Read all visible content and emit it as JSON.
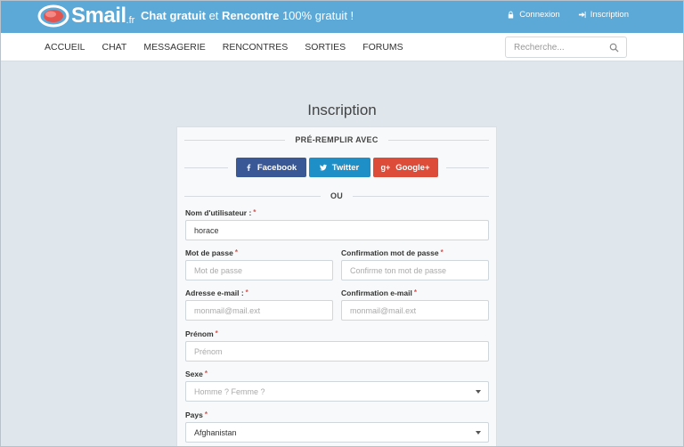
{
  "header": {
    "logo_text": "Smail",
    "logo_tld": ".fr",
    "tagline_part1": "Chat gratuit",
    "tagline_part2": " et ",
    "tagline_part3": "Rencontre",
    "tagline_part4": " 100% gratuit !",
    "connexion": "Connexion",
    "inscription": "Inscription",
    "accent_color": "#5ca8d6"
  },
  "nav": {
    "items": [
      "ACCUEIL",
      "CHAT",
      "MESSAGERIE",
      "RENCONTRES",
      "SORTIES",
      "FORUMS"
    ],
    "search_placeholder": "Recherche..."
  },
  "page": {
    "title": "Inscription"
  },
  "form": {
    "prefill_label": "PRÉ-REMPLIR AVEC",
    "or_label": "OU",
    "social": {
      "facebook": "Facebook",
      "twitter": "Twitter",
      "google": "Google+",
      "google_glyph": "g+"
    },
    "required_mark": "*",
    "username": {
      "label": "Nom d'utilisateur :",
      "value": "horace"
    },
    "password": {
      "label": "Mot de passe",
      "placeholder": "Mot de passe"
    },
    "password_confirm": {
      "label": "Confirmation mot de passe",
      "placeholder": "Confirme ton mot de passe"
    },
    "email": {
      "label": "Adresse e-mail :",
      "placeholder": "monmail@mail.ext"
    },
    "email_confirm": {
      "label": "Confirmation e-mail",
      "placeholder": "monmail@mail.ext"
    },
    "firstname": {
      "label": "Prénom",
      "placeholder": "Prénom"
    },
    "gender": {
      "label": "Sexe",
      "placeholder": "Homme ? Femme ?"
    },
    "country": {
      "label": "Pays",
      "value": "Afghanistan"
    }
  }
}
